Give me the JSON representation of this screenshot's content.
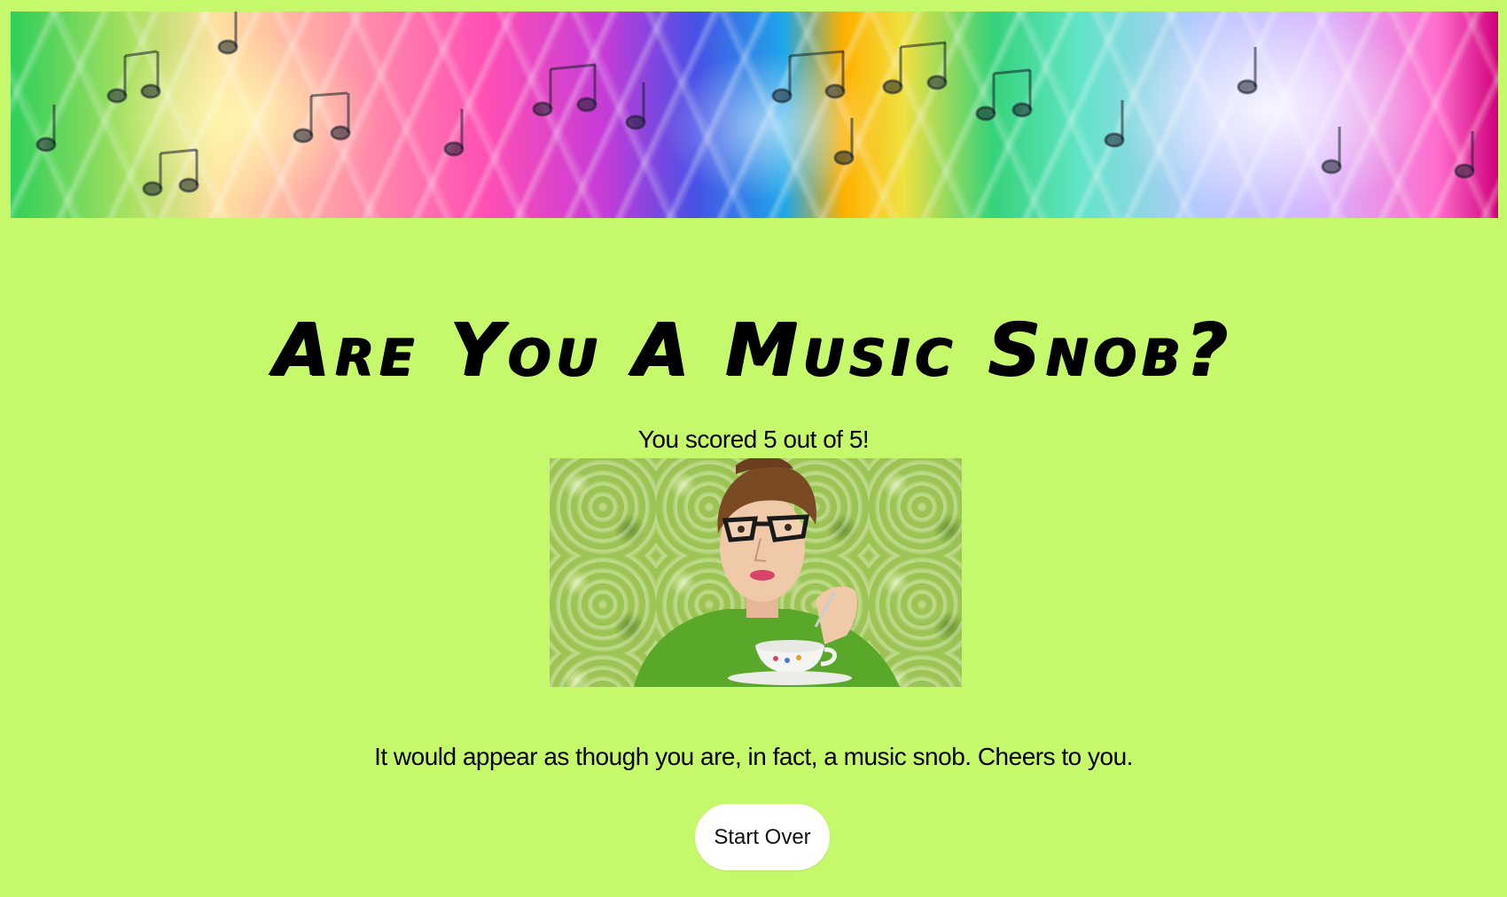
{
  "header": {
    "banner_image": "rainbow-music-notes-banner"
  },
  "main": {
    "title": "Are You A Music Snob?",
    "score_text": "You scored 5 out of 5!",
    "result_image": "woman-with-glasses-drinking-tea-photo",
    "result_message": "It would appear as though you are, in fact, a music snob. Cheers to you.",
    "start_over_label": "Start Over"
  },
  "colors": {
    "page_background": "#c6f86c",
    "button_background": "#ffffff",
    "text": "#000000"
  }
}
